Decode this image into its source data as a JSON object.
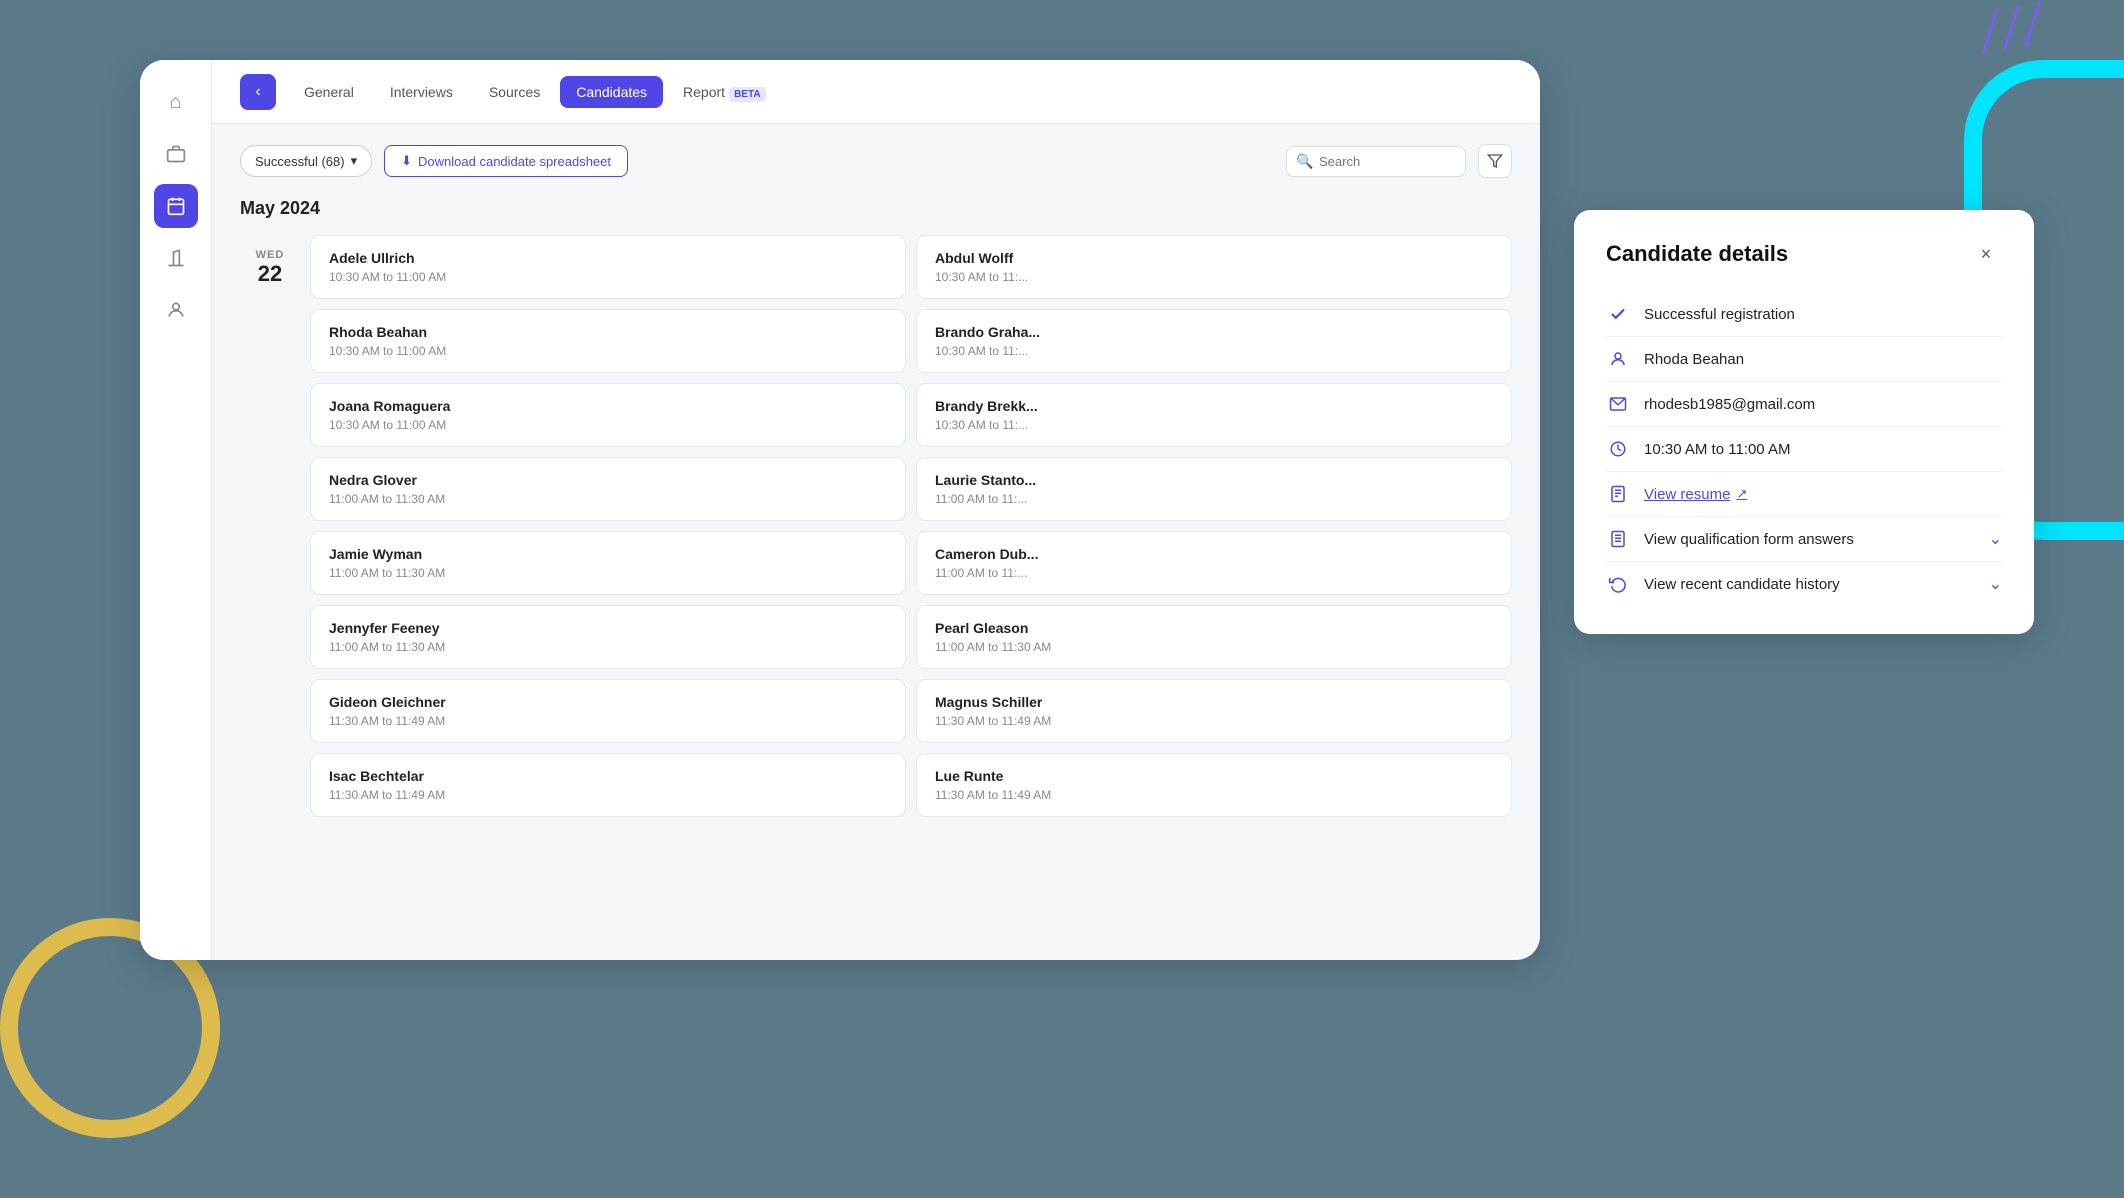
{
  "background": {
    "color": "#5a7a8a"
  },
  "sidebar": {
    "icons": [
      {
        "name": "home-icon",
        "glyph": "⌂",
        "active": false
      },
      {
        "name": "briefcase-icon",
        "glyph": "💼",
        "active": false
      },
      {
        "name": "calendar-icon",
        "glyph": "📅",
        "active": true
      },
      {
        "name": "building-icon",
        "glyph": "🏛",
        "active": false
      },
      {
        "name": "people-icon",
        "glyph": "👤",
        "active": false
      }
    ]
  },
  "nav": {
    "tabs": [
      {
        "label": "General",
        "active": false
      },
      {
        "label": "Interviews",
        "active": false
      },
      {
        "label": "Sources",
        "active": false
      },
      {
        "label": "Candidates",
        "active": true
      },
      {
        "label": "Report",
        "active": false,
        "badge": "BETA"
      }
    ]
  },
  "toolbar": {
    "filter_label": "Successful (68)",
    "download_label": "Download candidate spreadsheet",
    "search_placeholder": "Search"
  },
  "main": {
    "month_label": "May 2024",
    "day": {
      "dow": "WED",
      "dom": "22"
    },
    "candidates": [
      {
        "name": "Adele Ullrich",
        "time": "10:30 AM to 11:00 AM"
      },
      {
        "name": "Abdul Wolff",
        "time": "10:30 AM to 11:..."
      },
      {
        "name": "Rhoda Beahan",
        "time": "10:30 AM to 11:00 AM"
      },
      {
        "name": "Brando Graha...",
        "time": "10:30 AM to 11:..."
      },
      {
        "name": "Joana Romaguera",
        "time": "10:30 AM to 11:00 AM"
      },
      {
        "name": "Brandy Brekk...",
        "time": "10:30 AM to 11:..."
      },
      {
        "name": "Nedra Glover",
        "time": "11:00 AM to 11:30 AM"
      },
      {
        "name": "Laurie Stanto...",
        "time": "11:00 AM to 11:..."
      },
      {
        "name": "Jamie Wyman",
        "time": "11:00 AM to 11:30 AM"
      },
      {
        "name": "Cameron Dub...",
        "time": "11:00 AM to 11:..."
      },
      {
        "name": "Jennyfer Feeney",
        "time": "11:00 AM to 11:30 AM"
      },
      {
        "name": "Pearl Gleason",
        "time": "11:00 AM to 11:30 AM"
      },
      {
        "name": "Gideon Gleichner",
        "time": "11:30 AM to 11:49 AM"
      },
      {
        "name": "Magnus Schiller",
        "time": "11:30 AM to 11:49 AM"
      },
      {
        "name": "Isac Bechtelar",
        "time": "11:30 AM to 11:49 AM"
      },
      {
        "name": "Lue Runte",
        "time": "11:30 AM to 11:49 AM"
      }
    ]
  },
  "details_panel": {
    "title": "Candidate details",
    "close_label": "×",
    "rows": [
      {
        "icon": "check-icon",
        "icon_glyph": "✓",
        "text": "Successful registration",
        "type": "status"
      },
      {
        "icon": "person-icon",
        "icon_glyph": "👤",
        "text": "Rhoda Beahan",
        "type": "text"
      },
      {
        "icon": "email-icon",
        "icon_glyph": "✉",
        "text": "rhodesb1985@gmail.com",
        "type": "text"
      },
      {
        "icon": "clock-icon",
        "icon_glyph": "🕐",
        "text": "10:30 AM to 11:00 AM",
        "type": "text"
      },
      {
        "icon": "resume-icon",
        "icon_glyph": "📄",
        "text": "View resume",
        "type": "link",
        "link_icon": "↗"
      },
      {
        "icon": "form-icon",
        "icon_glyph": "📋",
        "text": "View qualification form answers",
        "type": "expandable"
      },
      {
        "icon": "history-icon",
        "icon_glyph": "🔄",
        "text": "View recent candidate history",
        "type": "expandable"
      }
    ]
  }
}
